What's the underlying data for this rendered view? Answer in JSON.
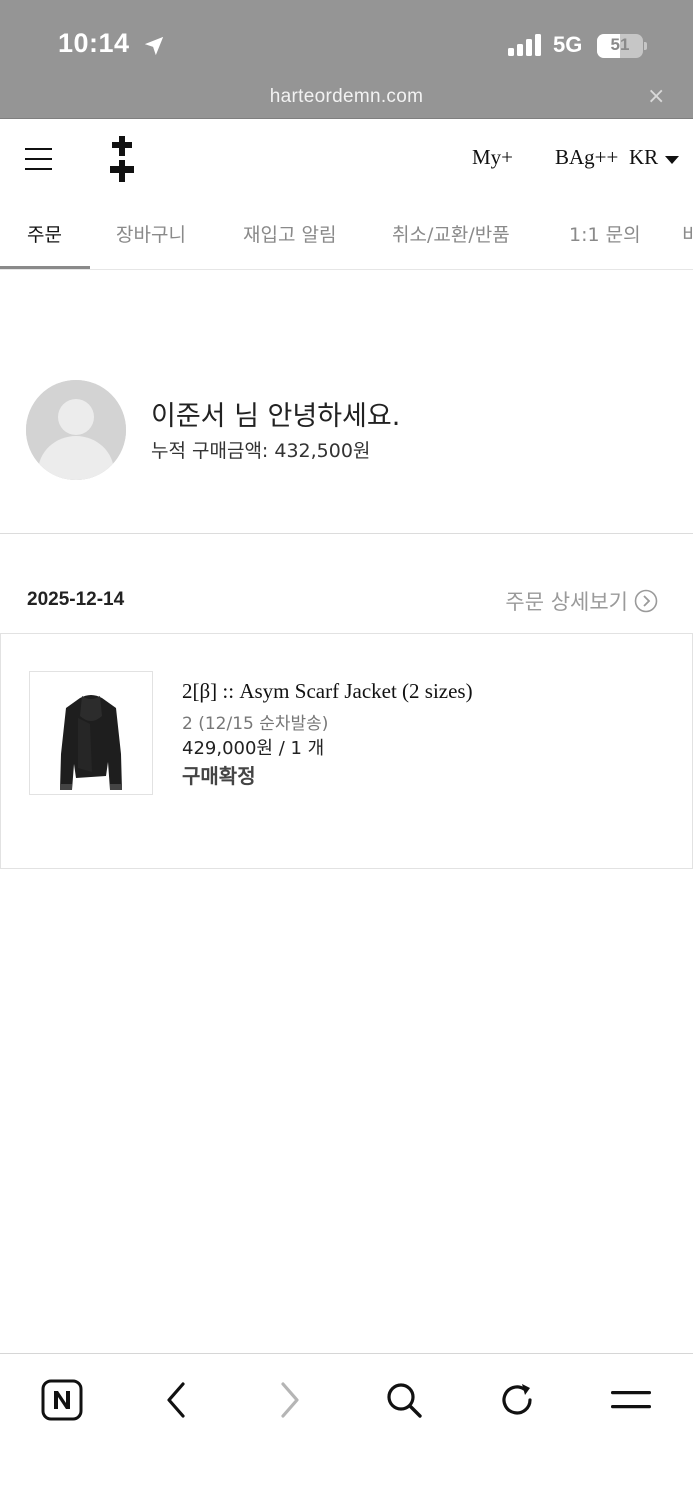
{
  "status_bar": {
    "time": "10:14",
    "network": "5G",
    "battery_percent": "51",
    "battery_level": 0.51
  },
  "url_bar": {
    "url": "harteordemn.com",
    "close_glyph": "×"
  },
  "header": {
    "my_link": "My+",
    "bag_link": "BAg++",
    "lang": "KR"
  },
  "tabs": [
    {
      "label": "주문",
      "active": true
    },
    {
      "label": "장바구니"
    },
    {
      "label": "재입고 알림"
    },
    {
      "label": "취소/교환/반품"
    },
    {
      "label": "1:1 문의"
    },
    {
      "label": "비"
    }
  ],
  "profile": {
    "greeting": "이준서 님 안녕하세요.",
    "total_purchase": "누적 구매금액: 432,500원"
  },
  "order": {
    "date": "2025-12-14",
    "detail_link": "주문 상세보기",
    "item": {
      "name": "2[β] :: Asym Scarf Jacket (2 sizes)",
      "option": "2 (12/15 순차발송)",
      "price_qty": "429,000원 / 1 개",
      "status": "구매확정"
    }
  },
  "toolbar": {
    "icons": [
      "naver-icon",
      "back-icon",
      "forward-icon",
      "search-icon",
      "refresh-icon",
      "menu-icon"
    ]
  },
  "colors": {
    "chrome_gray": "#959595",
    "tab_active": "#111111",
    "tab_inactive": "#8a8a8a"
  }
}
